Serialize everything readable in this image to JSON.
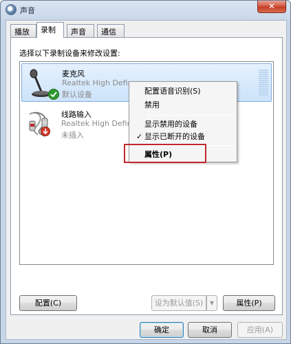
{
  "window": {
    "title": "声音",
    "close_label": "✕"
  },
  "tabs": [
    {
      "label": "播放"
    },
    {
      "label": "录制"
    },
    {
      "label": "声音"
    },
    {
      "label": "通信"
    }
  ],
  "instruction": "选择以下录制设备来修改设置:",
  "devices": [
    {
      "name": "麦克风",
      "driver": "Realtek High Defin",
      "status": "默认设备",
      "icon": "microphone-icon",
      "badge": "default-check-icon"
    },
    {
      "name": "线路输入",
      "driver": "Realtek High Defin",
      "status": "未插入",
      "icon": "line-in-jack-icon",
      "badge": "unplugged-arrow-icon"
    }
  ],
  "context_menu": {
    "items": [
      {
        "label": "配置语音识别(S)"
      },
      {
        "label": "禁用"
      },
      {
        "label": "显示禁用的设备"
      },
      {
        "label": "显示已断开的设备",
        "checked": true,
        "check_mark": "✓"
      },
      {
        "label": "属性(P)"
      }
    ]
  },
  "buttons": {
    "configure": "配置(C)",
    "set_default": "设为默认值(S)",
    "set_default_arrow": "▼",
    "properties": "属性(P)",
    "ok": "确定",
    "cancel": "取消",
    "apply": "应用(A)"
  },
  "colors": {
    "highlight_box": "#c0272d",
    "selection": "#cce3fb"
  }
}
